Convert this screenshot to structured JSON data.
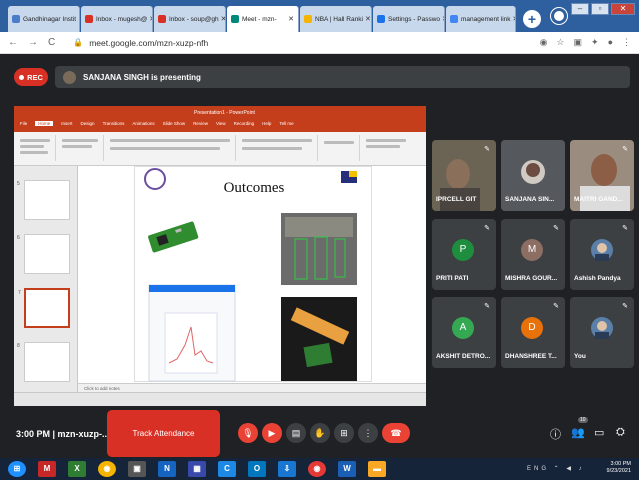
{
  "browser": {
    "tabs": [
      {
        "label": "Gandhinagar Instit",
        "color": "#4a7cc9"
      },
      {
        "label": "Inbox - mugesh@",
        "color": "#d93025"
      },
      {
        "label": "Inbox - soup@gh",
        "color": "#d93025"
      },
      {
        "label": "Meet - mzn-",
        "color": "#00897b"
      },
      {
        "label": "NBA | Hall Ranki",
        "color": "#f4b400"
      },
      {
        "label": "Settings - Passwo",
        "color": "#1a73e8"
      },
      {
        "label": "management link",
        "color": "#4285f4"
      }
    ],
    "new_tab": "+",
    "url": "meet.google.com/mzn-xuzp-nfh"
  },
  "meet": {
    "rec_label": "REC",
    "presenting_text": "SANJANA SINGH is presenting",
    "slide": {
      "window_title": "Presentation1 - PowerPoint",
      "ribbon_tabs": [
        "File",
        "Home",
        "Insert",
        "Design",
        "Transitions",
        "Animations",
        "Slide Show",
        "Review",
        "View",
        "Recording",
        "Help",
        "Tell me"
      ],
      "title": "Outcomes",
      "notes": "Click to add notes"
    },
    "participants": [
      {
        "name": "IPRCELL GIT",
        "type": "video",
        "color": "#6b6354"
      },
      {
        "name": "SANJANA SIN...",
        "type": "video",
        "color": "#8f8d88"
      },
      {
        "name": "MAITRI GAND...",
        "type": "video",
        "color": "#9a8c7e"
      },
      {
        "name": "PRITI PATI",
        "type": "avatar",
        "initial": "P",
        "color": "#1e8e3e"
      },
      {
        "name": "MISHRA GOUR...",
        "type": "avatar",
        "initial": "M",
        "color": "#8d6e63"
      },
      {
        "name": "Ashish Pandya",
        "type": "photo",
        "color": "#5a7fa8"
      },
      {
        "name": "AKSHIT DETRO...",
        "type": "avatar",
        "initial": "A",
        "color": "#34a853"
      },
      {
        "name": "DHANSHREE T...",
        "type": "avatar",
        "initial": "D",
        "color": "#e8710a"
      },
      {
        "name": "You",
        "type": "photo",
        "color": "#5a7fa8"
      }
    ],
    "time_code": "3:00 PM | mzn-xuzp-...",
    "track_attendance": "Track Attendance",
    "people_count": "10"
  },
  "taskbar": {
    "clock_time": "3:00 PM",
    "clock_date": "9/23/2021",
    "tray_lang": "ENG"
  }
}
